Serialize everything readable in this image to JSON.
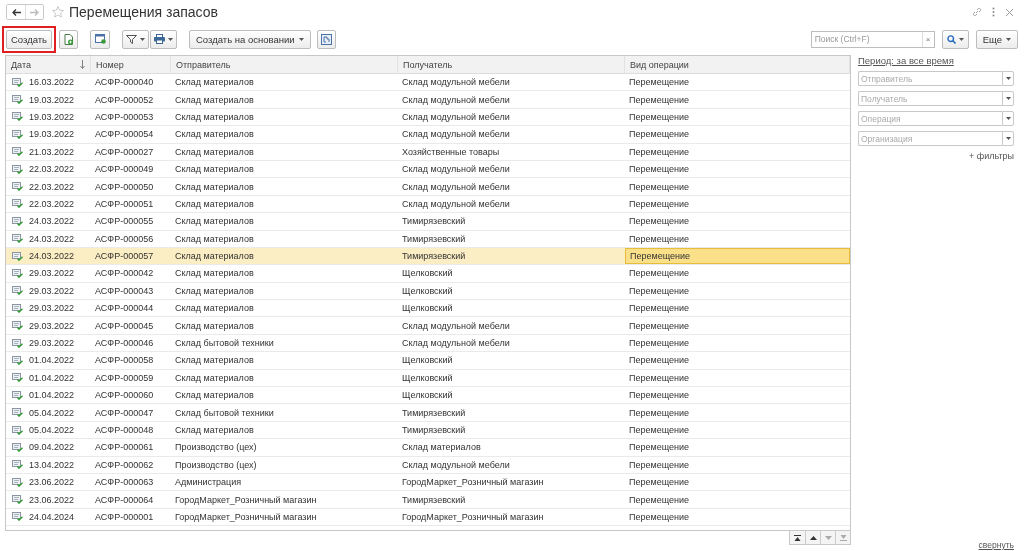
{
  "window": {
    "title": "Перемещения запасов",
    "back_disabled": false,
    "forward_disabled": true,
    "favorite": false
  },
  "toolbar": {
    "create": {
      "label": "Создать",
      "highlighted": true
    },
    "create_based": "Создать на основании",
    "search": {
      "placeholder": "Поиск (Ctrl+F)",
      "clear": "×"
    },
    "more": "Еще"
  },
  "table": {
    "columns": [
      {
        "label": "Дата",
        "sorted": true
      },
      {
        "label": "Номер",
        "sorted": false
      },
      {
        "label": "Отправитель",
        "sorted": false
      },
      {
        "label": "Получатель",
        "sorted": false
      },
      {
        "label": "Вид операции",
        "sorted": false
      }
    ],
    "rows": [
      {
        "date": "16.03.2022",
        "number": "АСФР-000040",
        "sender": "Склад материалов",
        "recipient": "Склад модульной мебели",
        "operation": "Перемещение",
        "posted": true,
        "selected": false
      },
      {
        "date": "19.03.2022",
        "number": "АСФР-000052",
        "sender": "Склад материалов",
        "recipient": "Склад модульной мебели",
        "operation": "Перемещение",
        "posted": true,
        "selected": false
      },
      {
        "date": "19.03.2022",
        "number": "АСФР-000053",
        "sender": "Склад материалов",
        "recipient": "Склад модульной мебели",
        "operation": "Перемещение",
        "posted": true,
        "selected": false
      },
      {
        "date": "19.03.2022",
        "number": "АСФР-000054",
        "sender": "Склад материалов",
        "recipient": "Склад модульной мебели",
        "operation": "Перемещение",
        "posted": true,
        "selected": false
      },
      {
        "date": "21.03.2022",
        "number": "АСФР-000027",
        "sender": "Склад материалов",
        "recipient": "Хозяйственные товары",
        "operation": "Перемещение",
        "posted": true,
        "selected": false
      },
      {
        "date": "22.03.2022",
        "number": "АСФР-000049",
        "sender": "Склад материалов",
        "recipient": "Склад модульной мебели",
        "operation": "Перемещение",
        "posted": true,
        "selected": false
      },
      {
        "date": "22.03.2022",
        "number": "АСФР-000050",
        "sender": "Склад материалов",
        "recipient": "Склад модульной мебели",
        "operation": "Перемещение",
        "posted": true,
        "selected": false
      },
      {
        "date": "22.03.2022",
        "number": "АСФР-000051",
        "sender": "Склад материалов",
        "recipient": "Склад модульной мебели",
        "operation": "Перемещение",
        "posted": true,
        "selected": false
      },
      {
        "date": "24.03.2022",
        "number": "АСФР-000055",
        "sender": "Склад материалов",
        "recipient": "Тимирязевский",
        "operation": "Перемещение",
        "posted": true,
        "selected": false
      },
      {
        "date": "24.03.2022",
        "number": "АСФР-000056",
        "sender": "Склад материалов",
        "recipient": "Тимирязевский",
        "operation": "Перемещение",
        "posted": true,
        "selected": false
      },
      {
        "date": "24.03.2022",
        "number": "АСФР-000057",
        "sender": "Склад материалов",
        "recipient": "Тимирязевский",
        "operation": "Перемещение",
        "posted": true,
        "selected": true
      },
      {
        "date": "29.03.2022",
        "number": "АСФР-000042",
        "sender": "Склад материалов",
        "recipient": "Щелковский",
        "operation": "Перемещение",
        "posted": true,
        "selected": false
      },
      {
        "date": "29.03.2022",
        "number": "АСФР-000043",
        "sender": "Склад материалов",
        "recipient": "Щелковский",
        "operation": "Перемещение",
        "posted": true,
        "selected": false
      },
      {
        "date": "29.03.2022",
        "number": "АСФР-000044",
        "sender": "Склад материалов",
        "recipient": "Щелковский",
        "operation": "Перемещение",
        "posted": true,
        "selected": false
      },
      {
        "date": "29.03.2022",
        "number": "АСФР-000045",
        "sender": "Склад материалов",
        "recipient": "Склад модульной мебели",
        "operation": "Перемещение",
        "posted": true,
        "selected": false
      },
      {
        "date": "29.03.2022",
        "number": "АСФР-000046",
        "sender": "Склад бытовой техники",
        "recipient": "Склад модульной мебели",
        "operation": "Перемещение",
        "posted": true,
        "selected": false
      },
      {
        "date": "01.04.2022",
        "number": "АСФР-000058",
        "sender": "Склад материалов",
        "recipient": "Щелковский",
        "operation": "Перемещение",
        "posted": true,
        "selected": false
      },
      {
        "date": "01.04.2022",
        "number": "АСФР-000059",
        "sender": "Склад материалов",
        "recipient": "Щелковский",
        "operation": "Перемещение",
        "posted": true,
        "selected": false
      },
      {
        "date": "01.04.2022",
        "number": "АСФР-000060",
        "sender": "Склад материалов",
        "recipient": "Щелковский",
        "operation": "Перемещение",
        "posted": true,
        "selected": false
      },
      {
        "date": "05.04.2022",
        "number": "АСФР-000047",
        "sender": "Склад бытовой техники",
        "recipient": "Тимирязевский",
        "operation": "Перемещение",
        "posted": true,
        "selected": false
      },
      {
        "date": "05.04.2022",
        "number": "АСФР-000048",
        "sender": "Склад материалов",
        "recipient": "Тимирязевский",
        "operation": "Перемещение",
        "posted": true,
        "selected": false
      },
      {
        "date": "09.04.2022",
        "number": "АСФР-000061",
        "sender": "Производство (цех)",
        "recipient": "Склад материалов",
        "operation": "Перемещение",
        "posted": true,
        "selected": false
      },
      {
        "date": "13.04.2022",
        "number": "АСФР-000062",
        "sender": "Производство (цех)",
        "recipient": "Склад модульной мебели",
        "operation": "Перемещение",
        "posted": true,
        "selected": false
      },
      {
        "date": "23.06.2022",
        "number": "АСФР-000063",
        "sender": "Администрация",
        "recipient": "ГородМаркет_Розничный магазин",
        "operation": "Перемещение",
        "posted": true,
        "selected": false
      },
      {
        "date": "23.06.2022",
        "number": "АСФР-000064",
        "sender": "ГородМаркет_Розничный магазин",
        "recipient": "Тимирязевский",
        "operation": "Перемещение",
        "posted": true,
        "selected": false
      },
      {
        "date": "24.04.2024",
        "number": "АСФР-000001",
        "sender": "ГородМаркет_Розничный магазин",
        "recipient": "ГородМаркет_Розничный магазин",
        "operation": "Перемещение",
        "posted": true,
        "selected": false
      }
    ],
    "nav_buttons": [
      {
        "kind": "first",
        "disabled": false
      },
      {
        "kind": "up",
        "disabled": false
      },
      {
        "kind": "down",
        "disabled": true
      },
      {
        "kind": "last",
        "disabled": true
      }
    ]
  },
  "filters": {
    "period": "Период: за все время",
    "fields": [
      {
        "placeholder": "Отправитель"
      },
      {
        "placeholder": "Получатель"
      },
      {
        "placeholder": "Операция"
      },
      {
        "placeholder": "Организация"
      }
    ],
    "more": "+ фильтры"
  },
  "collapse": "свернуть"
}
